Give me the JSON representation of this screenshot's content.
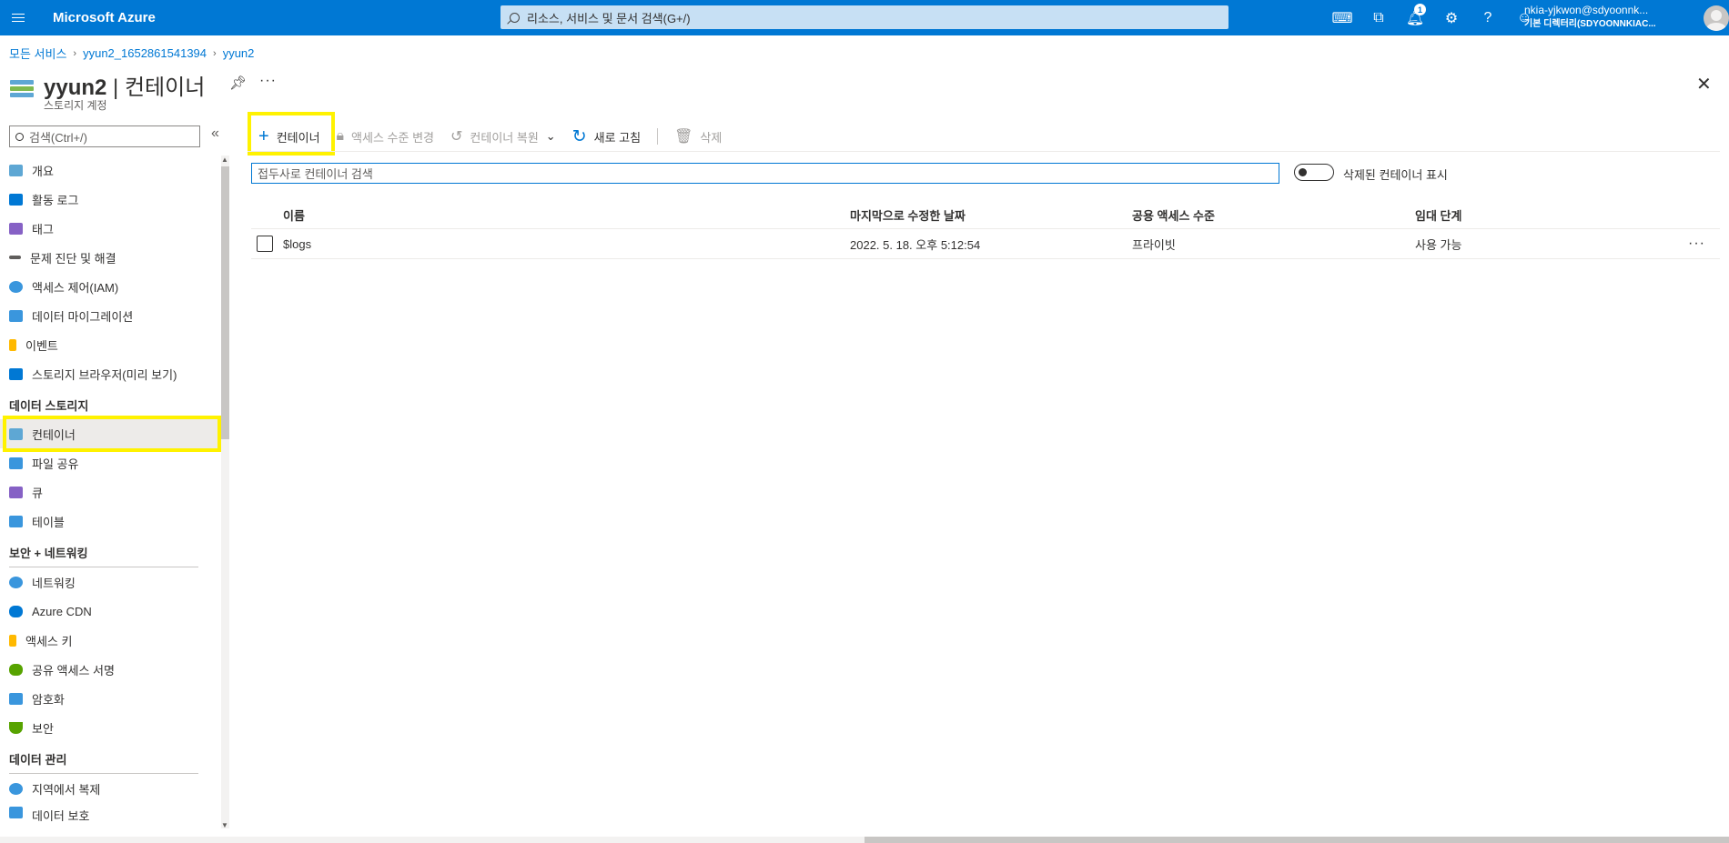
{
  "topbar": {
    "brand": "Microsoft Azure",
    "search_placeholder": "리소스, 서비스 및 문서 검색(G+/)",
    "notification_count": "1",
    "account_line1": "nkia-yjkwon@sdyoonnk...",
    "account_line2": "기본 디렉터리(SDYOONNKIAC..."
  },
  "breadcrumb": [
    "모든 서비스",
    "yyun2_1652861541394",
    "yyun2"
  ],
  "page": {
    "title_name": "yyun2",
    "title_sep": " | ",
    "title_section": "컨테이너",
    "subtitle": "스토리지 계정",
    "more": "···"
  },
  "sidebar": {
    "search_placeholder": "검색(Ctrl+/)",
    "items_top": [
      {
        "label": "개요",
        "color": "#5ea7d4"
      },
      {
        "label": "활동 로그",
        "color": "#0078d4"
      },
      {
        "label": "태그",
        "color": "#8661c5"
      },
      {
        "label": "문제 진단 및 해결",
        "color": "#605e5c"
      },
      {
        "label": "액세스 제어(IAM)",
        "color": "#3a96dd"
      },
      {
        "label": "데이터 마이그레이션",
        "color": "#3a96dd"
      },
      {
        "label": "이벤트",
        "color": "#ffb900"
      },
      {
        "label": "스토리지 브라우저(미리 보기)",
        "color": "#0078d4"
      }
    ],
    "section_data_storage": "데이터 스토리지",
    "items_storage": [
      {
        "label": "컨테이너",
        "color": "#5ea7d4"
      },
      {
        "label": "파일 공유",
        "color": "#3a96dd"
      },
      {
        "label": "큐",
        "color": "#8661c5"
      },
      {
        "label": "테이블",
        "color": "#3a96dd"
      }
    ],
    "section_security": "보안 + 네트워킹",
    "items_security": [
      {
        "label": "네트워킹",
        "color": "#3a96dd"
      },
      {
        "label": "Azure CDN",
        "color": "#0078d4"
      },
      {
        "label": "액세스 키",
        "color": "#ffb900"
      },
      {
        "label": "공유 액세스 서명",
        "color": "#57a300"
      },
      {
        "label": "암호화",
        "color": "#3a96dd"
      },
      {
        "label": "보안",
        "color": "#57a300"
      }
    ],
    "section_data_mgmt": "데이터 관리",
    "items_mgmt": [
      {
        "label": "지역에서 복제",
        "color": "#3a96dd"
      },
      {
        "label": "데이터 보호",
        "color": "#3a96dd"
      }
    ]
  },
  "toolbar": {
    "add": "컨테이너",
    "access_level": "액세스 수준 변경",
    "restore": "컨테이너 복원",
    "refresh": "새로 고침",
    "delete": "삭제"
  },
  "filter": {
    "placeholder": "접두사로 컨테이너 검색",
    "toggle_label": "삭제된 컨테이너 표시"
  },
  "table": {
    "headers": {
      "name": "이름",
      "modified": "마지막으로 수정한 날짜",
      "access": "공용 액세스 수준",
      "lease": "임대 단계"
    },
    "rows": [
      {
        "name": "$logs",
        "modified": "2022. 5. 18. 오후 5:12:54",
        "access": "프라이빗",
        "lease": "사용 가능"
      }
    ]
  }
}
